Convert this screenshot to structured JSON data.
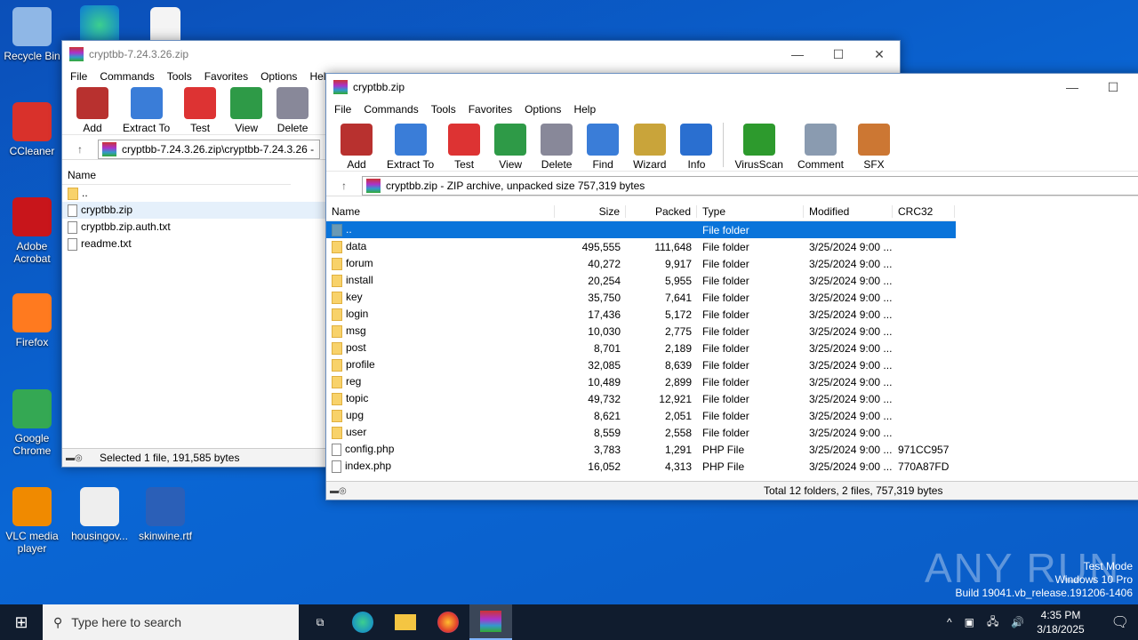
{
  "desktop": {
    "icons": [
      {
        "label": "Recycle Bin",
        "icon": "recycle-bin-icon"
      },
      {
        "label": "CCleaner",
        "icon": "ccleaner-icon"
      },
      {
        "label": "Adobe Acrobat",
        "icon": "acrobat-icon"
      },
      {
        "label": "Firefox",
        "icon": "firefox-icon"
      },
      {
        "label": "Google Chrome",
        "icon": "chrome-icon"
      },
      {
        "label": "VLC media player",
        "icon": "vlc-icon"
      },
      {
        "label": "housingov...",
        "icon": "image-file-icon"
      },
      {
        "label": "skinwine.rtf",
        "icon": "word-file-icon"
      }
    ]
  },
  "back_window": {
    "title": "cryptbb-7.24.3.26.zip",
    "menu": [
      "File",
      "Commands",
      "Tools",
      "Favorites",
      "Options",
      "Help"
    ],
    "toolbar": [
      "Add",
      "Extract To",
      "Test",
      "View",
      "Delete"
    ],
    "address": "cryptbb-7.24.3.26.zip\\cryptbb-7.24.3.26 - ",
    "column": "Name",
    "files": [
      "..",
      "cryptbb.zip",
      "cryptbb.zip.auth.txt",
      "readme.txt"
    ],
    "status": "Selected 1 file, 191,585 bytes"
  },
  "front_window": {
    "title": "cryptbb.zip",
    "menu": [
      "File",
      "Commands",
      "Tools",
      "Favorites",
      "Options",
      "Help"
    ],
    "toolbar": [
      "Add",
      "Extract To",
      "Test",
      "View",
      "Delete",
      "Find",
      "Wizard",
      "Info",
      "VirusScan",
      "Comment",
      "SFX"
    ],
    "address": "cryptbb.zip - ZIP archive, unpacked size 757,319 bytes",
    "columns": [
      "Name",
      "Size",
      "Packed",
      "Type",
      "Modified",
      "CRC32"
    ],
    "rows": [
      {
        "name": "..",
        "size": "",
        "packed": "",
        "type": "File folder",
        "modified": "",
        "crc": "",
        "kind": "up"
      },
      {
        "name": "data",
        "size": "495,555",
        "packed": "111,648",
        "type": "File folder",
        "modified": "3/25/2024 9:00 ...",
        "crc": "",
        "kind": "folder"
      },
      {
        "name": "forum",
        "size": "40,272",
        "packed": "9,917",
        "type": "File folder",
        "modified": "3/25/2024 9:00 ...",
        "crc": "",
        "kind": "folder"
      },
      {
        "name": "install",
        "size": "20,254",
        "packed": "5,955",
        "type": "File folder",
        "modified": "3/25/2024 9:00 ...",
        "crc": "",
        "kind": "folder"
      },
      {
        "name": "key",
        "size": "35,750",
        "packed": "7,641",
        "type": "File folder",
        "modified": "3/25/2024 9:00 ...",
        "crc": "",
        "kind": "folder"
      },
      {
        "name": "login",
        "size": "17,436",
        "packed": "5,172",
        "type": "File folder",
        "modified": "3/25/2024 9:00 ...",
        "crc": "",
        "kind": "folder"
      },
      {
        "name": "msg",
        "size": "10,030",
        "packed": "2,775",
        "type": "File folder",
        "modified": "3/25/2024 9:00 ...",
        "crc": "",
        "kind": "folder"
      },
      {
        "name": "post",
        "size": "8,701",
        "packed": "2,189",
        "type": "File folder",
        "modified": "3/25/2024 9:00 ...",
        "crc": "",
        "kind": "folder"
      },
      {
        "name": "profile",
        "size": "32,085",
        "packed": "8,639",
        "type": "File folder",
        "modified": "3/25/2024 9:00 ...",
        "crc": "",
        "kind": "folder"
      },
      {
        "name": "reg",
        "size": "10,489",
        "packed": "2,899",
        "type": "File folder",
        "modified": "3/25/2024 9:00 ...",
        "crc": "",
        "kind": "folder"
      },
      {
        "name": "topic",
        "size": "49,732",
        "packed": "12,921",
        "type": "File folder",
        "modified": "3/25/2024 9:00 ...",
        "crc": "",
        "kind": "folder"
      },
      {
        "name": "upg",
        "size": "8,621",
        "packed": "2,051",
        "type": "File folder",
        "modified": "3/25/2024 9:00 ...",
        "crc": "",
        "kind": "folder"
      },
      {
        "name": "user",
        "size": "8,559",
        "packed": "2,558",
        "type": "File folder",
        "modified": "3/25/2024 9:00 ...",
        "crc": "",
        "kind": "folder"
      },
      {
        "name": "config.php",
        "size": "3,783",
        "packed": "1,291",
        "type": "PHP File",
        "modified": "3/25/2024 9:00 ...",
        "crc": "971CC957",
        "kind": "file"
      },
      {
        "name": "index.php",
        "size": "16,052",
        "packed": "4,313",
        "type": "PHP File",
        "modified": "3/25/2024 9:00 ...",
        "crc": "770A87FD",
        "kind": "file"
      }
    ],
    "status": "Total 12 folders, 2 files, 757,319 bytes"
  },
  "watermark": {
    "logo": "ANY RUN",
    "line1": "Test Mode",
    "line2": "Windows 10 Pro",
    "line3": "Build 19041.vb_release.191206-1406"
  },
  "taskbar": {
    "search_placeholder": "Type here to search",
    "time": "4:35 PM",
    "date": "3/18/2025"
  }
}
